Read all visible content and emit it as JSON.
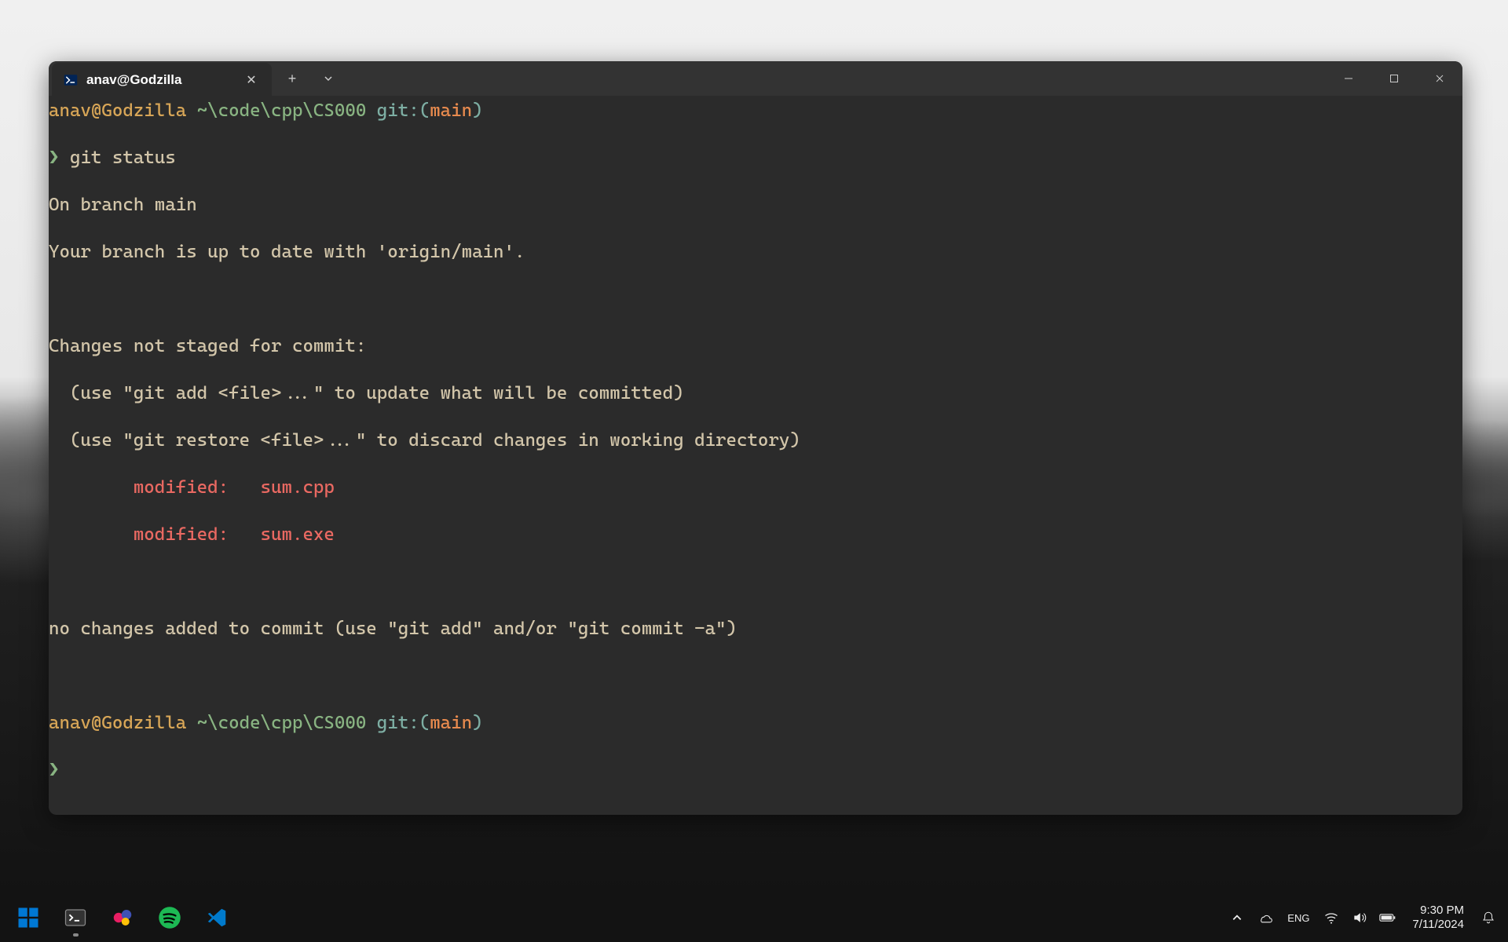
{
  "window": {
    "tab_title": "anav@Godzilla"
  },
  "terminal": {
    "userhost": "anav@Godzilla",
    "path": "~\\code\\cpp\\CS000",
    "git_label": "git:(",
    "branch": "main",
    "git_close": ")",
    "prompt_glyph": "❯",
    "command": "git status",
    "out_branch": "On branch main",
    "out_uptodate": "Your branch is up to date with 'origin/main'.",
    "out_notstaged": "Changes not staged for commit:",
    "out_hint_add": "  (use \"git add <file>...\" to update what will be committed)",
    "out_hint_restore": "  (use \"git restore <file>...\" to discard changes in working directory)",
    "out_mod1": "        modified:   sum.cpp",
    "out_mod2": "        modified:   sum.exe",
    "out_nochanges": "no changes added to commit (use \"git add\" and/or \"git commit -a\")"
  },
  "taskbar": {
    "time": "9:30 PM",
    "date": "7/11/2024"
  }
}
